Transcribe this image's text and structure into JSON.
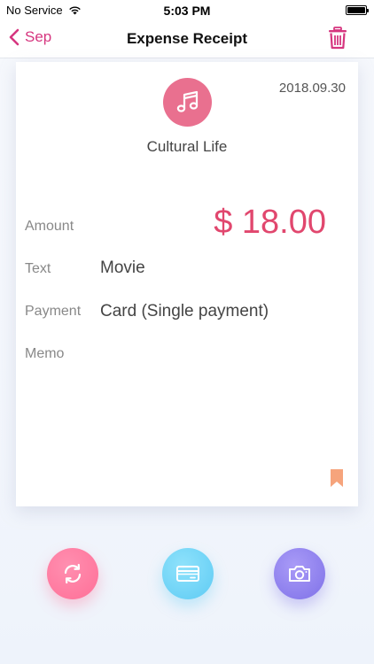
{
  "status_bar": {
    "carrier": "No Service",
    "time": "5:03 PM",
    "icons": [
      "wifi-icon",
      "battery-icon"
    ]
  },
  "nav": {
    "back_label": "Sep",
    "title": "Expense Receipt",
    "icons": [
      "chevron-left-icon",
      "trash-icon"
    ]
  },
  "receipt": {
    "date": "2018.09.30",
    "category_icon": "music-note-icon",
    "category": "Cultural Life",
    "amount_label": "Amount",
    "amount": "$ 18.00",
    "text_label": "Text",
    "text_value": "Movie",
    "payment_label": "Payment",
    "payment_value": "Card (Single payment)",
    "memo_label": "Memo",
    "memo_value": "",
    "bookmark_icon": "bookmark-icon"
  },
  "actions": {
    "icons": [
      "repeat-icon",
      "credit-card-icon",
      "camera-icon"
    ]
  },
  "colors": {
    "accent": "#d6367f",
    "amount": "#e1476e",
    "category_bg": "#e9708f",
    "repeat_btn": "#ff7a9f",
    "card_btn": "#6fd2f6",
    "camera_btn": "#8d7ff0",
    "bookmark": "#f6a47c"
  }
}
